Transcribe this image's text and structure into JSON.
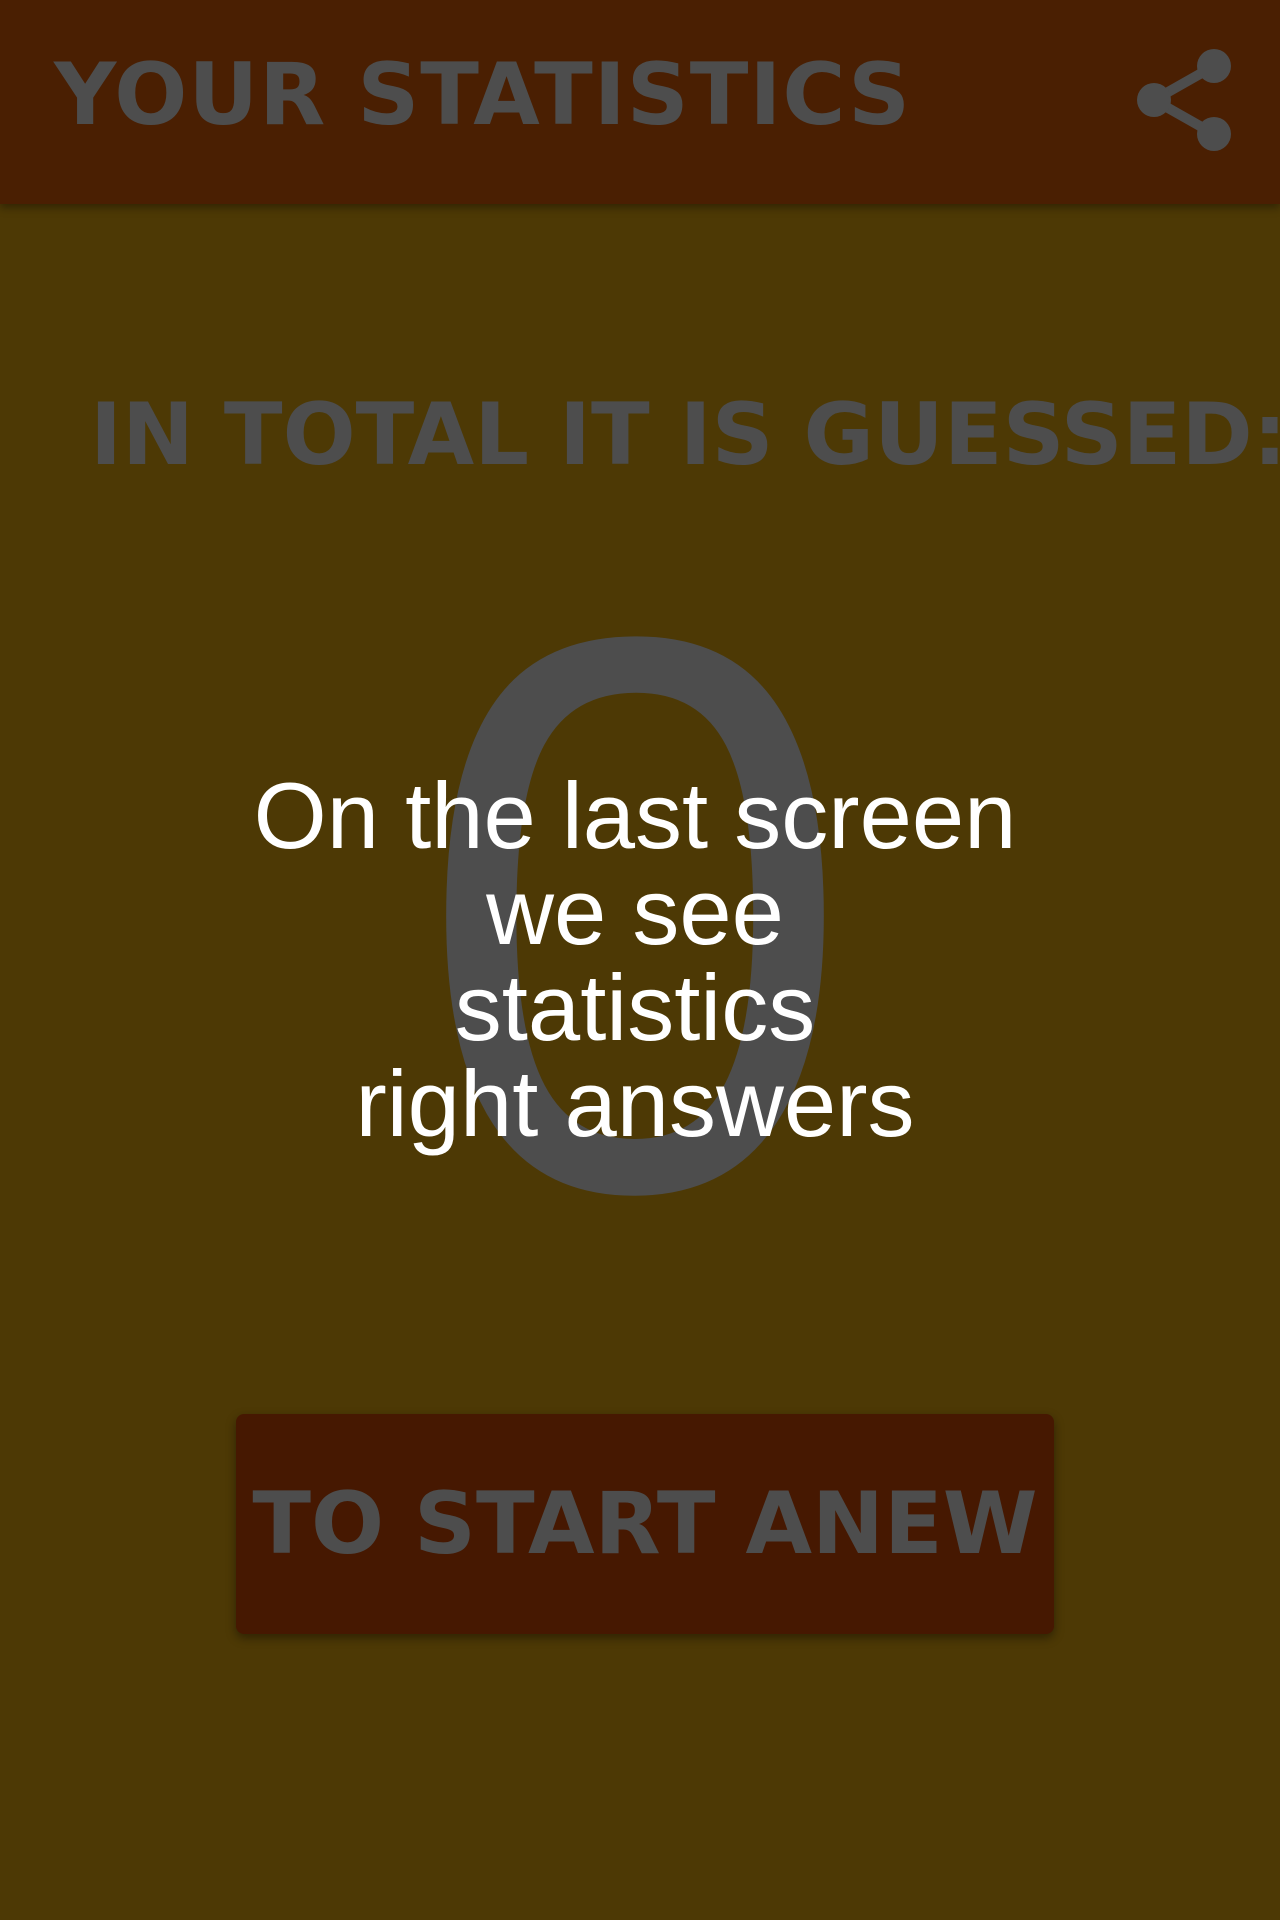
{
  "app_bar": {
    "title": "YOUR STATISTICS",
    "share_icon": "share-icon"
  },
  "stats": {
    "total_label": "IN TOTAL IT IS GUESSED:",
    "count": "0"
  },
  "overlay": {
    "lines": [
      "On the last screen",
      "we see",
      "statistics",
      "right answers"
    ]
  },
  "actions": {
    "restart_label": "TO START ANEW"
  },
  "colors": {
    "background": "#4d3905",
    "app_bar": "#4a1f02",
    "button": "#461801",
    "muted_text": "#4d4d4d",
    "overlay_text": "#ffffff"
  }
}
